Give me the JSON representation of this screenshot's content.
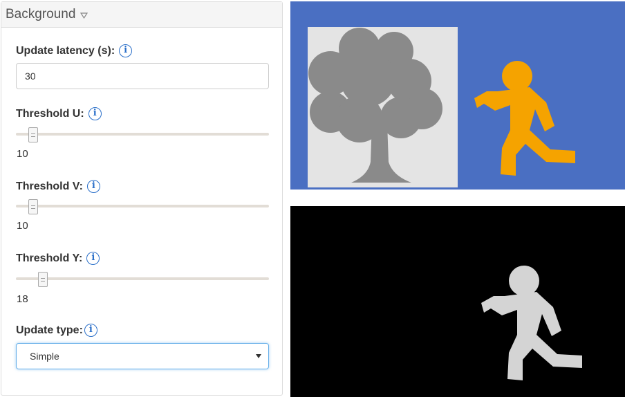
{
  "panel": {
    "title": "Background",
    "header_icon": "triangle-down-icon"
  },
  "update_latency": {
    "label": "Update latency (s):",
    "value": "30",
    "info_icon": "info-icon"
  },
  "threshold_u": {
    "label": "Threshold U:",
    "value": "10",
    "slider_fraction": 0.05
  },
  "threshold_v": {
    "label": "Threshold V:",
    "value": "10",
    "slider_fraction": 0.05
  },
  "threshold_y": {
    "label": "Threshold Y:",
    "value": "18",
    "slider_fraction": 0.09
  },
  "update_type": {
    "label": "Update type:",
    "selected": "Simple"
  },
  "info_glyph": "i",
  "preview_top": {
    "background_color": "#4a6fc2",
    "tree_box_color": "#e4e4e4",
    "tree_color": "#8a8a8a",
    "runner_color": "#f5a300"
  },
  "preview_bottom": {
    "background_color": "#000000",
    "runner_color": "#d4d4d4"
  }
}
